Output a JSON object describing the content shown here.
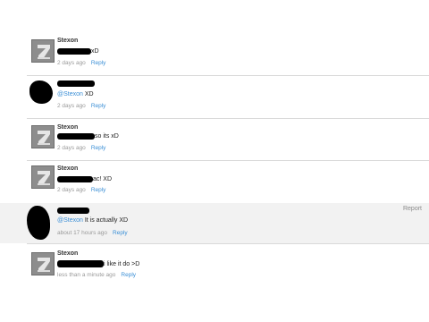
{
  "comments": [
    {
      "author": "Stexon",
      "text_after": "xD",
      "time": "2 days ago",
      "reply": "Reply"
    },
    {
      "author": "",
      "mention": "@Stexon",
      "text_after": " XD",
      "time": "2 days ago",
      "reply": "Reply"
    },
    {
      "author": "Stexon",
      "text_after": "so its xD",
      "time": "2 days ago",
      "reply": "Reply"
    },
    {
      "author": "Stexon",
      "text_after": "ac! XD",
      "time": "2 days ago",
      "reply": "Reply"
    },
    {
      "author": "",
      "mention": "@Stexon",
      "text_after": " It is actually XD",
      "time": "about 17 hours ago",
      "reply": "Reply",
      "report": "Report"
    },
    {
      "author": "Stexon",
      "text_after": "i like it do >D",
      "time": "less than a minute ago",
      "reply": "Reply"
    }
  ],
  "colors": {
    "link": "#3b8fd6",
    "meta": "#9a9a9a",
    "highlight_bg": "#f2f2f2"
  },
  "icons": {
    "avatar": "default-avatar-icon"
  }
}
